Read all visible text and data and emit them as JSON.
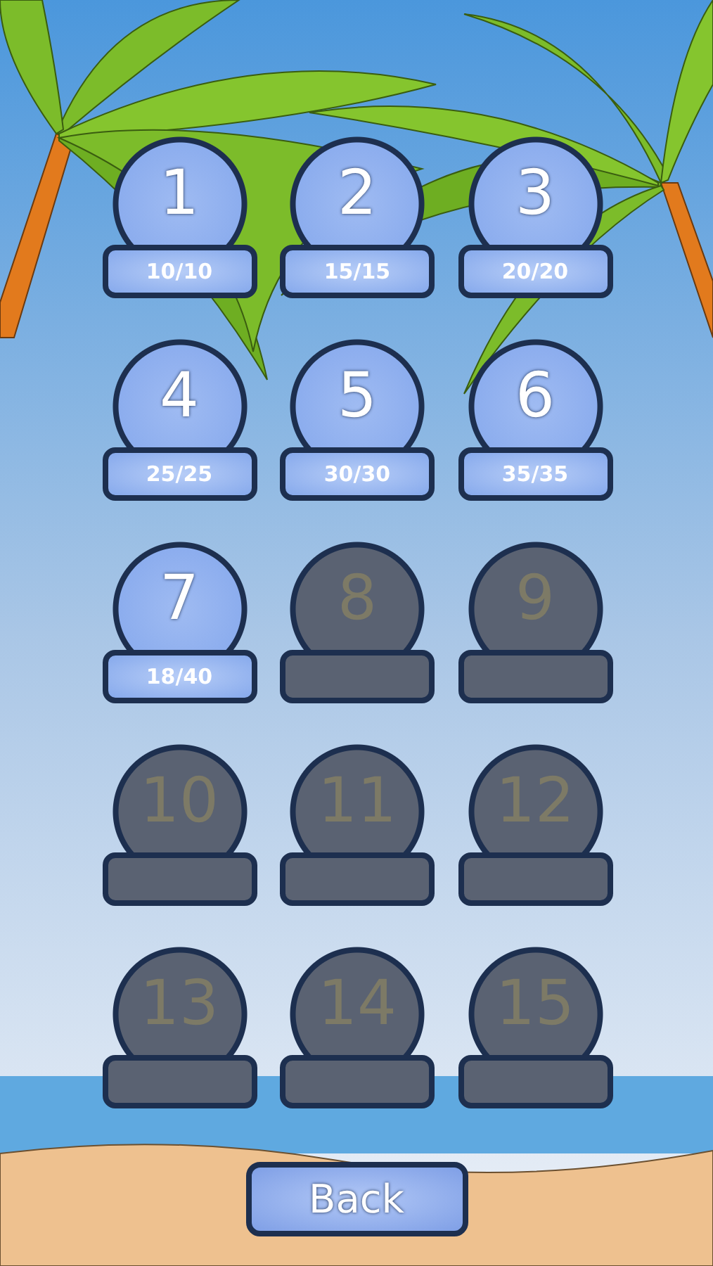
{
  "levels": [
    {
      "number": "1",
      "locked": false,
      "score": "10/10"
    },
    {
      "number": "2",
      "locked": false,
      "score": "15/15"
    },
    {
      "number": "3",
      "locked": false,
      "score": "20/20"
    },
    {
      "number": "4",
      "locked": false,
      "score": "25/25"
    },
    {
      "number": "5",
      "locked": false,
      "score": "30/30"
    },
    {
      "number": "6",
      "locked": false,
      "score": "35/35"
    },
    {
      "number": "7",
      "locked": false,
      "score": "18/40"
    },
    {
      "number": "8",
      "locked": true
    },
    {
      "number": "9",
      "locked": true
    },
    {
      "number": "10",
      "locked": true
    },
    {
      "number": "11",
      "locked": true
    },
    {
      "number": "12",
      "locked": true
    },
    {
      "number": "13",
      "locked": true
    },
    {
      "number": "14",
      "locked": true
    },
    {
      "number": "15",
      "locked": true
    }
  ],
  "back_button": {
    "label": "Back"
  }
}
